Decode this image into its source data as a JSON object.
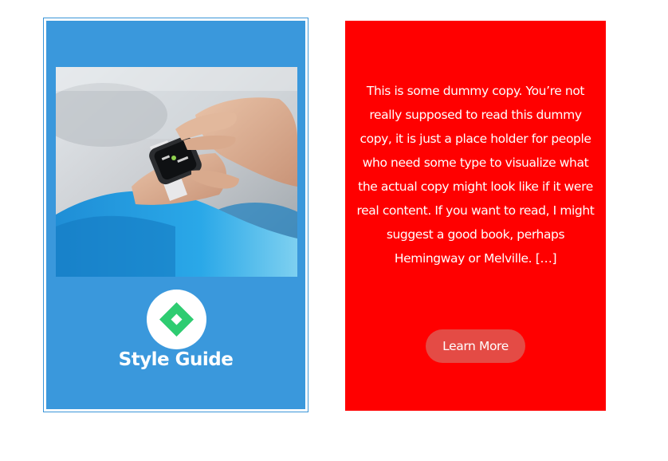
{
  "left_card": {
    "image_alt": "Hand touching a smartwatch on a wrist",
    "logo_icon": "diamond-logo-icon",
    "title": "Style Guide"
  },
  "right_card": {
    "body": "This is some dummy copy. You’re not really supposed to read this dummy copy, it is just a place holder for people who need some type to visualize what the actual copy might look like if it were real content. If you want to read, I might suggest a good book, perhaps Hemingway or Melville. […]",
    "button_label": "Learn More"
  },
  "colors": {
    "left_card_bg": "#3a98dc",
    "right_card_bg": "#ff0000",
    "button_bg": "#e44b45",
    "logo_green": "#2ecc71"
  }
}
